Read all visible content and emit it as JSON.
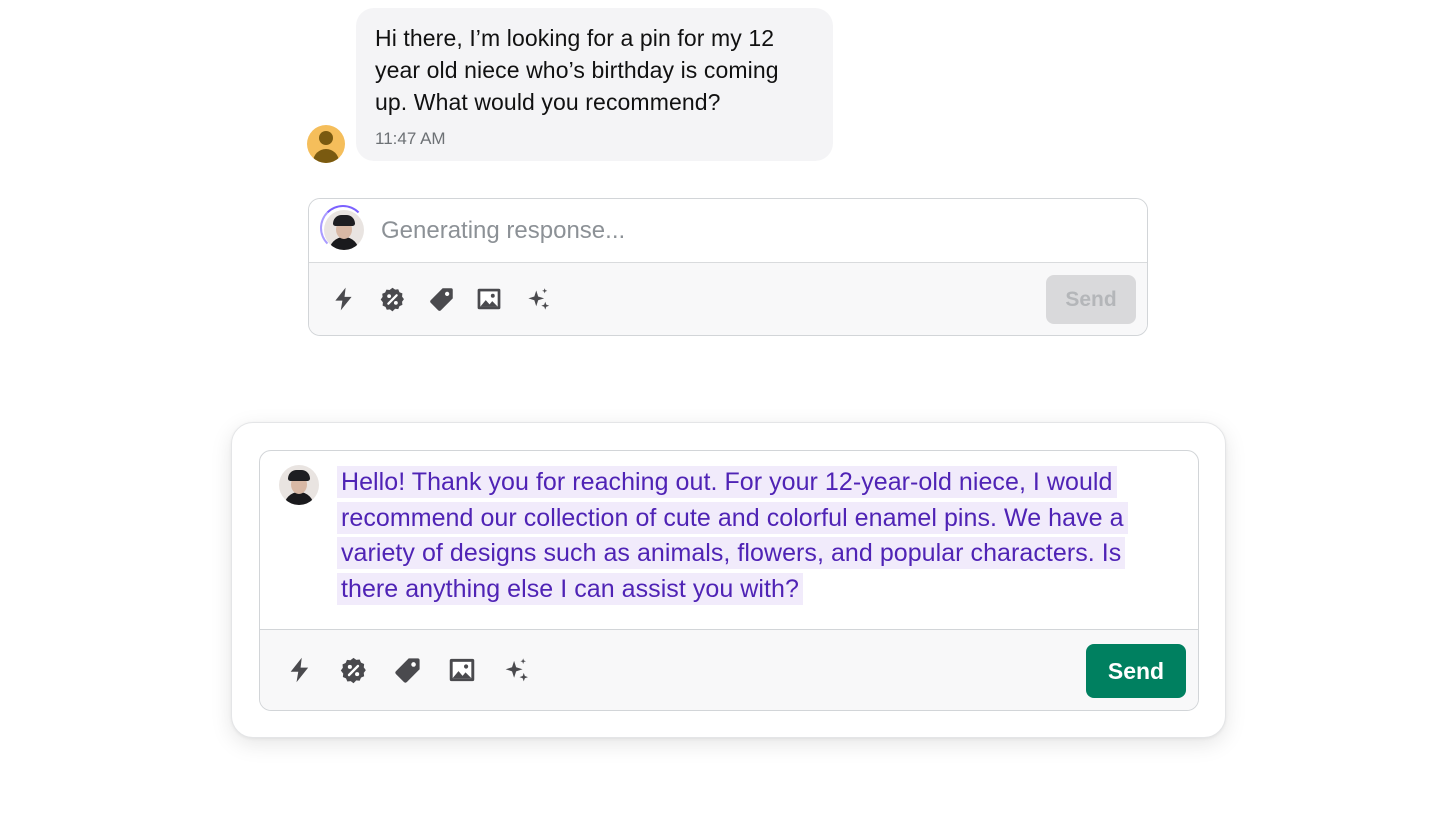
{
  "customer_message": {
    "text": "Hi there, I’m looking for a pin for my 12 year old niece who’s birthday is coming up. What would you recommend?",
    "timestamp": "11:47 AM"
  },
  "composer_generating": {
    "placeholder": "Generating response...",
    "send_label": "Send",
    "toolbar_icons": [
      "lightning-icon",
      "discount-icon",
      "tag-icon",
      "image-icon",
      "sparkles-icon"
    ]
  },
  "composer_response": {
    "text": "Hello! Thank you for reaching out. For your 12-year-old niece, I would recommend our collection of cute and colorful enamel pins. We have a variety of designs such as animals, flowers, and popular characters. Is there anything else I can assist you with?",
    "send_label": "Send",
    "toolbar_icons": [
      "lightning-icon",
      "discount-icon",
      "tag-icon",
      "image-icon",
      "sparkles-icon"
    ]
  },
  "colors": {
    "send_active": "#008060",
    "send_disabled": "#d9d9db",
    "ai_text": "#4f23b5",
    "ai_highlight": "#f1ebfb",
    "spinner": "#7b61ff",
    "customer_avatar": "#f5be5b"
  }
}
